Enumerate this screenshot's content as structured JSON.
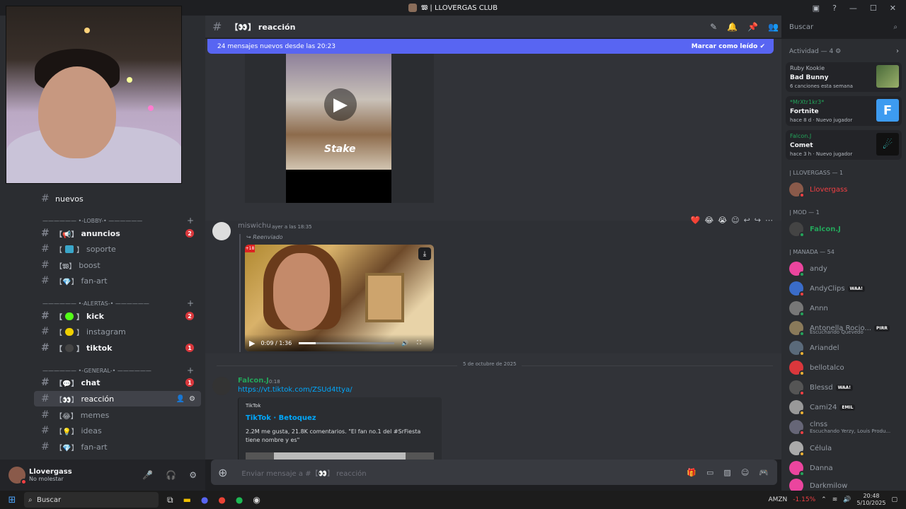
{
  "window": {
    "title": "𝖂 | LLOVERGAS CLUB"
  },
  "channel": {
    "name": "【👀】 reacción"
  },
  "search": {
    "placeholder": "Buscar"
  },
  "newbar": {
    "text": "24 mensajes nuevos desde las 20:23",
    "mark": "Marcar como leído"
  },
  "sidebar": {
    "nuevos": "nuevos",
    "cat_lobby": "—————— •-LOBBY-• ——————",
    "cat_alertas": "—————— •-ALERTAS-• ——————",
    "cat_general": "—————— •-GENERAL-• ——————",
    "channels": [
      {
        "label": "anuncios",
        "badge": "2"
      },
      {
        "label": "soporte"
      },
      {
        "label": "boost"
      },
      {
        "label": "fan-art"
      },
      {
        "label": "kick",
        "badge": "2"
      },
      {
        "label": "instagram"
      },
      {
        "label": "tiktok",
        "badge": "1"
      },
      {
        "label": "chat",
        "badge": "1"
      },
      {
        "label": "reacción"
      },
      {
        "label": "memes"
      },
      {
        "label": "ideas"
      },
      {
        "label": "fan-art"
      }
    ]
  },
  "user": {
    "name": "Llovergass",
    "status": "No molestar"
  },
  "messages": {
    "m1": {
      "author": "miswichu",
      "time": "ayer a las 18:35",
      "forwarded": "Reenviado",
      "video_time": "0:09 / 1:36",
      "progress": 0.18
    },
    "date_divider": "5 de octubre de 2025",
    "m2": {
      "author": "Falcon.J",
      "time": "0:18",
      "link": "https://vt.tiktok.com/ZSUd4ttya/",
      "embed_provider": "TikTok",
      "embed_title": "TikTok · Betoquez",
      "embed_desc": "2.2M me gusta, 21.8K comentarios. \"El fan no.1 del #SrFiesta tiene nombre y es\""
    }
  },
  "composer": {
    "placeholder": "Enviar mensaje a #【👀】 reacción"
  },
  "members": {
    "activity_header": "Actividad — 4",
    "activities": [
      {
        "user": "Ruby Kookie",
        "title": "Bad Bunny",
        "sub": "6 canciones esta semana"
      },
      {
        "user": "*MrXtr1kr3*",
        "title": "Fortnite",
        "sub": "hace 8 d · Nuevo jugador"
      },
      {
        "user": "Falcon.J",
        "title": "Comet",
        "sub": "hace 3 h · Nuevo jugador"
      }
    ],
    "groups": {
      "g1": "| LLOVERGASS — 1",
      "g2": "| MOD — 1",
      "g3": "| MANADA — 54"
    },
    "list": [
      {
        "name": "Llovergass"
      },
      {
        "name": "Falcon.J"
      },
      {
        "name": "andy"
      },
      {
        "name": "AndyClips",
        "tag": "WAA!"
      },
      {
        "name": "Annn"
      },
      {
        "name": "Antonella Rocio...",
        "tag": "PIRR",
        "sub": "Escuchando Quevedo"
      },
      {
        "name": "Ariandel"
      },
      {
        "name": "bellotalco"
      },
      {
        "name": "Blessd",
        "tag": "WAA!"
      },
      {
        "name": "Cami24",
        "tag": "EMIL"
      },
      {
        "name": "clnss",
        "sub": "Escuchando Yerzy, Louis Produ..."
      },
      {
        "name": "Célula"
      },
      {
        "name": "Danna"
      },
      {
        "name": "Darkmilow"
      }
    ]
  },
  "taskbar": {
    "search": "Buscar",
    "stock": "AMZN",
    "stock_change": "-1.15%",
    "time": "20:48",
    "date": "5/10/2025"
  },
  "colors": {
    "accent": "#5865f2",
    "link": "#00a8fc",
    "green_name": "#23a55a",
    "red_name": "#f23f43"
  }
}
